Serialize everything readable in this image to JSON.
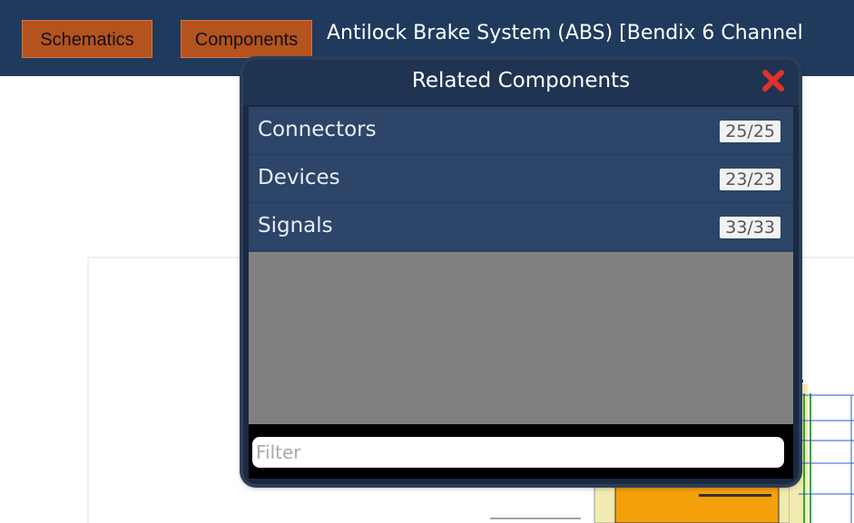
{
  "topbar": {
    "schematics_label": "Schematics",
    "components_label": "Components",
    "title": "Antilock Brake System (ABS) [Bendix 6 Channel"
  },
  "popup": {
    "title": "Related Components",
    "items": [
      {
        "label": "Connectors",
        "count": "25/25"
      },
      {
        "label": "Devices",
        "count": "23/23"
      },
      {
        "label": "Signals",
        "count": "33/33"
      }
    ],
    "filter_placeholder": "Filter"
  },
  "colors": {
    "topbar_bg": "#1f3a5c",
    "button_bg": "#b5531f",
    "popup_bg": "#1c2a40",
    "row_bg": "#2c4568",
    "empty_bg": "#808080",
    "close_icon": "#e0322d",
    "schematic_orange": "#f5a00a",
    "schematic_yellow": "#f2ebb0",
    "schematic_green": "#2faa2f",
    "schematic_blue": "#3355cc"
  },
  "icons": {
    "close": "close-icon"
  }
}
